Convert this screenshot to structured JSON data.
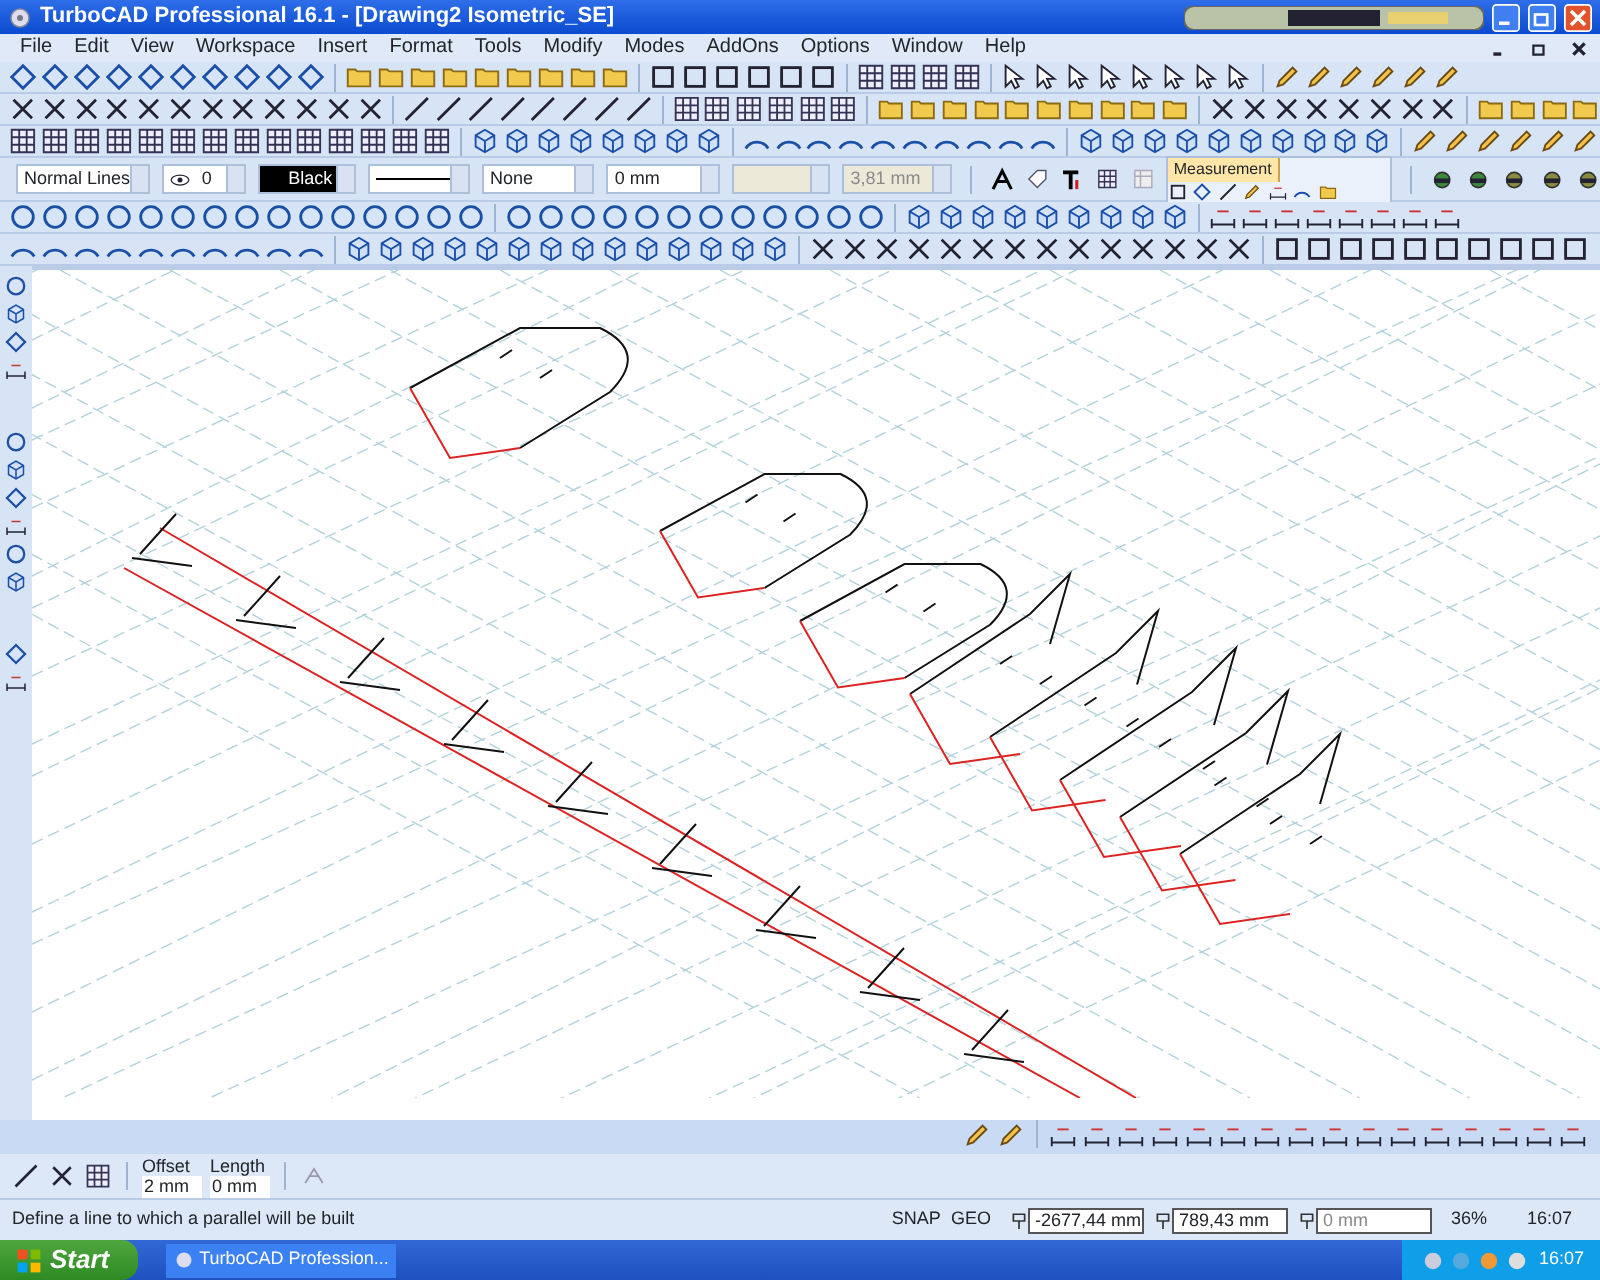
{
  "window": {
    "title": "TurboCAD Professional 16.1 - [Drawing2 Isometric_SE]"
  },
  "menu": [
    "File",
    "Edit",
    "View",
    "Workspace",
    "Insert",
    "Format",
    "Tools",
    "Modify",
    "Modes",
    "AddOns",
    "Options",
    "Window",
    "Help"
  ],
  "property_bar": [
    {
      "kind": "combo",
      "value": "Normal Lines",
      "disabled": false
    },
    {
      "kind": "layer",
      "value": "0",
      "disabled": false
    },
    {
      "kind": "color",
      "value": "Black",
      "disabled": false
    },
    {
      "kind": "linestyle",
      "disabled": false
    },
    {
      "kind": "combo",
      "value": "None",
      "disabled": false
    },
    {
      "kind": "combo",
      "value": "0 mm",
      "disabled": false
    },
    {
      "kind": "combo",
      "disabled": true
    },
    {
      "kind": "combo",
      "value": "3,81 mm",
      "disabled": true
    }
  ],
  "palette_tab": {
    "label": "Measurement"
  },
  "input_bar": [
    {
      "label": "Offset",
      "value": "2 mm"
    },
    {
      "label": "Length",
      "value": "0 mm"
    }
  ],
  "status_bar": {
    "prompt": "Define a line to which a parallel will be built",
    "snap": "SNAP",
    "geo": "GEO",
    "coords": [
      {
        "value": "-2677,44 mm",
        "disabled": false
      },
      {
        "value": "789,43 mm",
        "disabled": false
      },
      {
        "value": "0 mm",
        "disabled": true
      }
    ],
    "zoom": "36%",
    "time": "16:07"
  },
  "taskbar": {
    "start": "Start",
    "tasks": [
      "TurboCAD Profession..."
    ],
    "clock": "16:07"
  }
}
